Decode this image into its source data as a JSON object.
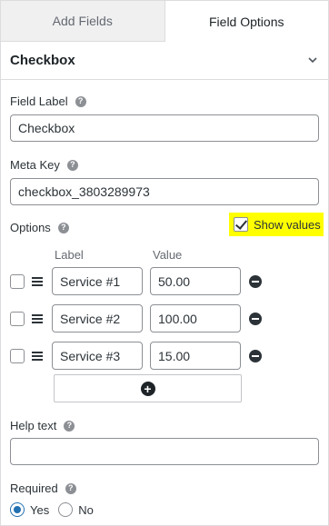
{
  "tabs": {
    "add_fields": "Add Fields",
    "field_options": "Field Options"
  },
  "section": {
    "title": "Checkbox"
  },
  "field_label": {
    "label": "Field Label",
    "value": "Checkbox"
  },
  "meta_key": {
    "label": "Meta Key",
    "value": "checkbox_3803289973"
  },
  "options": {
    "label": "Options",
    "show_values_label": "Show values",
    "show_values_checked": true,
    "col_label": "Label",
    "col_value": "Value",
    "items": [
      {
        "label": "Service #1",
        "value": "50.00"
      },
      {
        "label": "Service #2",
        "value": "100.00"
      },
      {
        "label": "Service #3",
        "value": "15.00"
      }
    ]
  },
  "help_text": {
    "label": "Help text",
    "value": ""
  },
  "required": {
    "label": "Required",
    "yes": "Yes",
    "no": "No",
    "selected": "yes"
  },
  "icons": {
    "help": "question-circle-icon",
    "chevron": "chevron-down-icon",
    "drag": "drag-handle-icon",
    "remove": "minus-circle-icon",
    "add": "plus-circle-icon"
  },
  "colors": {
    "highlight": "#ffff00",
    "accent": "#2271b1"
  }
}
